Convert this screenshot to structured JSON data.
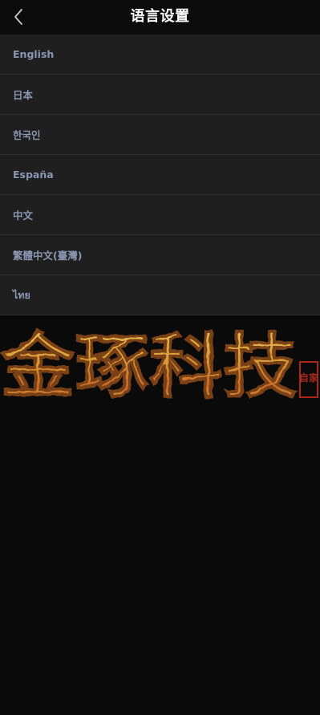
{
  "header": {
    "title": "语言设置",
    "back_icon": "chevron-left-icon"
  },
  "languages": [
    {
      "label": "English"
    },
    {
      "label": "日本"
    },
    {
      "label": "한국인"
    },
    {
      "label": "España"
    },
    {
      "label": "中文"
    },
    {
      "label": "繁體中文(臺灣)"
    },
    {
      "label": "ไทย"
    }
  ],
  "banner": {
    "calligraphy_text": "金琢科技",
    "seal_text": "自家",
    "gold_color": "#d9a43a",
    "seal_color": "#a8281e"
  },
  "colors": {
    "background": "#0a0a0a",
    "header_bg": "#0c0c0c",
    "item_bg": "#1f1f1f",
    "divider": "#303030",
    "item_text": "#8a96b2",
    "title_text": "#ffffff"
  }
}
